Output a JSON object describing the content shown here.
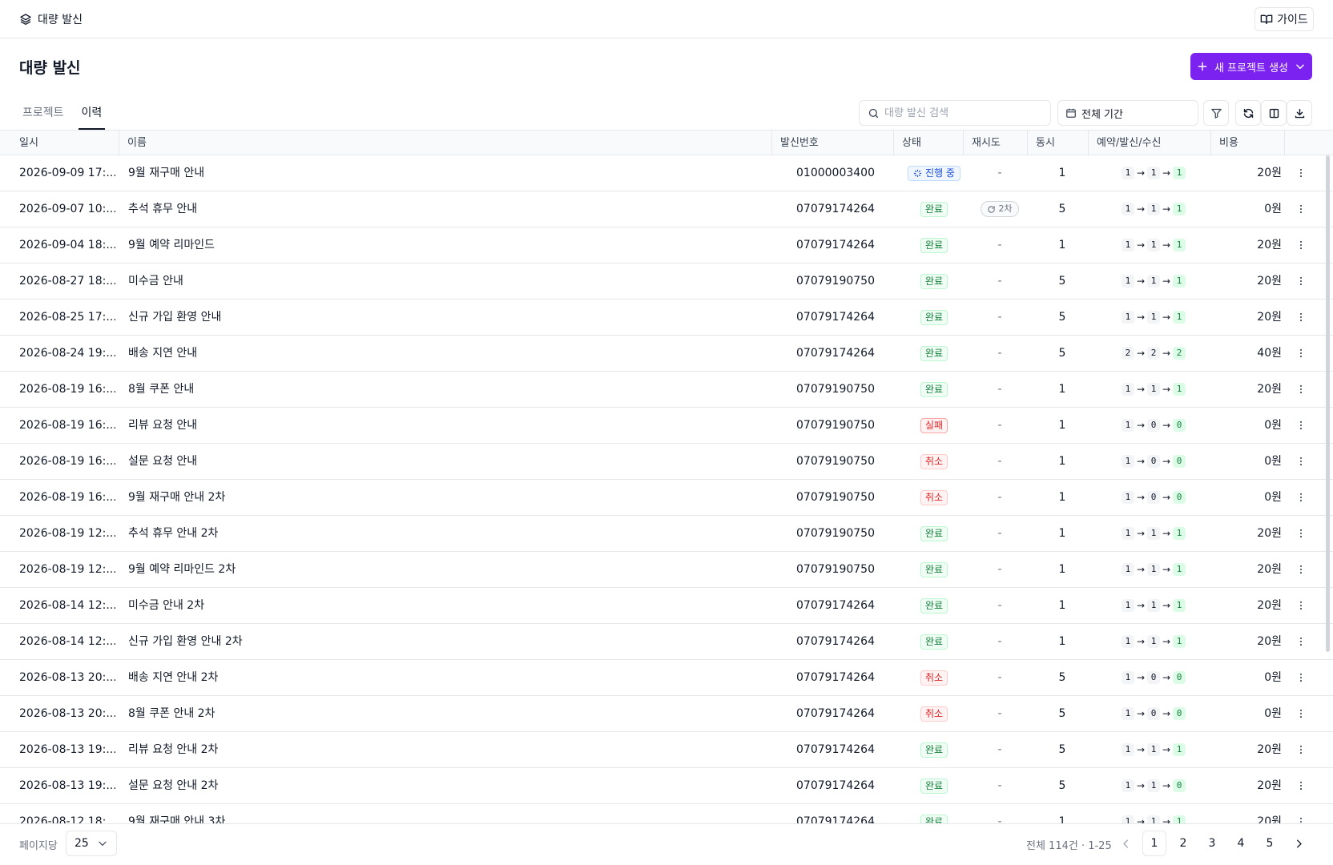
{
  "topbar": {
    "breadcrumb": "대량 발신",
    "guide_label": "가이드"
  },
  "page": {
    "title": "대량 발신",
    "new_project_label": "새 프로젝트 생성"
  },
  "tabs": [
    {
      "label": "프로젝트"
    },
    {
      "label": "이력"
    }
  ],
  "toolbar": {
    "search_placeholder": "대량 발신 검색",
    "period_label": "전체 기간"
  },
  "columns": {
    "date": "일시",
    "name": "이름",
    "number": "발신번호",
    "status": "상태",
    "retry": "재시도",
    "concurrent": "동시",
    "flow": "예약/발신/수신",
    "cost": "비용"
  },
  "colors": {
    "accent": "#7c22f0",
    "done": "#15803d",
    "fail": "#dc2626",
    "progress": "#1d4ed8"
  },
  "rows": [
    {
      "date": "2026-09-09 17:...",
      "name": "9월 재구매 안내",
      "number": "01000003400",
      "status": "진행 중",
      "status_type": "progress",
      "retry": "-",
      "concurrent": "1",
      "reserved": "1",
      "sent": "1",
      "received": "1",
      "cost": "20원"
    },
    {
      "date": "2026-09-07 10:...",
      "name": "추석 휴무 안내",
      "number": "07079174264",
      "status": "완료",
      "status_type": "done",
      "retry": "2차",
      "concurrent": "5",
      "reserved": "1",
      "sent": "1",
      "received": "1",
      "cost": "0원"
    },
    {
      "date": "2026-09-04 18:...",
      "name": "9월 예약 리마인드",
      "number": "07079174264",
      "status": "완료",
      "status_type": "done",
      "retry": "-",
      "concurrent": "1",
      "reserved": "1",
      "sent": "1",
      "received": "1",
      "cost": "20원"
    },
    {
      "date": "2026-08-27 18:...",
      "name": "미수금 안내",
      "number": "07079190750",
      "status": "완료",
      "status_type": "done",
      "retry": "-",
      "concurrent": "5",
      "reserved": "1",
      "sent": "1",
      "received": "1",
      "cost": "20원"
    },
    {
      "date": "2026-08-25 17:...",
      "name": "신규 가입 환영 안내",
      "number": "07079174264",
      "status": "완료",
      "status_type": "done",
      "retry": "-",
      "concurrent": "5",
      "reserved": "1",
      "sent": "1",
      "received": "1",
      "cost": "20원"
    },
    {
      "date": "2026-08-24 19:...",
      "name": "배송 지연 안내",
      "number": "07079174264",
      "status": "완료",
      "status_type": "done",
      "retry": "-",
      "concurrent": "5",
      "reserved": "2",
      "sent": "2",
      "received": "2",
      "cost": "40원"
    },
    {
      "date": "2026-08-19 16:...",
      "name": "8월 쿠폰 안내",
      "number": "07079190750",
      "status": "완료",
      "status_type": "done",
      "retry": "-",
      "concurrent": "1",
      "reserved": "1",
      "sent": "1",
      "received": "1",
      "cost": "20원"
    },
    {
      "date": "2026-08-19 16:...",
      "name": "리뷰 요청 안내",
      "number": "07079190750",
      "status": "실패",
      "status_type": "fail",
      "retry": "-",
      "concurrent": "1",
      "reserved": "1",
      "sent": "0",
      "received": "0",
      "cost": "0원"
    },
    {
      "date": "2026-08-19 16:...",
      "name": "설문 요청 안내",
      "number": "07079190750",
      "status": "취소",
      "status_type": "cancel",
      "retry": "-",
      "concurrent": "1",
      "reserved": "1",
      "sent": "0",
      "received": "0",
      "cost": "0원"
    },
    {
      "date": "2026-08-19 16:...",
      "name": "9월 재구매 안내 2차",
      "number": "07079190750",
      "status": "취소",
      "status_type": "cancel",
      "retry": "-",
      "concurrent": "1",
      "reserved": "1",
      "sent": "0",
      "received": "0",
      "cost": "0원"
    },
    {
      "date": "2026-08-19 12:...",
      "name": "추석 휴무 안내 2차",
      "number": "07079190750",
      "status": "완료",
      "status_type": "done",
      "retry": "-",
      "concurrent": "1",
      "reserved": "1",
      "sent": "1",
      "received": "1",
      "cost": "20원"
    },
    {
      "date": "2026-08-19 12:...",
      "name": "9월 예약 리마인드 2차",
      "number": "07079190750",
      "status": "완료",
      "status_type": "done",
      "retry": "-",
      "concurrent": "1",
      "reserved": "1",
      "sent": "1",
      "received": "1",
      "cost": "20원"
    },
    {
      "date": "2026-08-14 12:...",
      "name": "미수금 안내 2차",
      "number": "07079174264",
      "status": "완료",
      "status_type": "done",
      "retry": "-",
      "concurrent": "1",
      "reserved": "1",
      "sent": "1",
      "received": "1",
      "cost": "20원"
    },
    {
      "date": "2026-08-14 12:...",
      "name": "신규 가입 환영 안내 2차",
      "number": "07079174264",
      "status": "완료",
      "status_type": "done",
      "retry": "-",
      "concurrent": "1",
      "reserved": "1",
      "sent": "1",
      "received": "1",
      "cost": "20원"
    },
    {
      "date": "2026-08-13 20:...",
      "name": "배송 지연 안내 2차",
      "number": "07079174264",
      "status": "취소",
      "status_type": "cancel",
      "retry": "-",
      "concurrent": "5",
      "reserved": "1",
      "sent": "0",
      "received": "0",
      "cost": "0원"
    },
    {
      "date": "2026-08-13 20:...",
      "name": "8월 쿠폰 안내 2차",
      "number": "07079174264",
      "status": "취소",
      "status_type": "cancel",
      "retry": "-",
      "concurrent": "5",
      "reserved": "1",
      "sent": "0",
      "received": "0",
      "cost": "0원"
    },
    {
      "date": "2026-08-13 19:...",
      "name": "리뷰 요청 안내 2차",
      "number": "07079174264",
      "status": "완료",
      "status_type": "done",
      "retry": "-",
      "concurrent": "5",
      "reserved": "1",
      "sent": "1",
      "received": "1",
      "cost": "20원"
    },
    {
      "date": "2026-08-13 19:...",
      "name": "설문 요청 안내 2차",
      "number": "07079174264",
      "status": "완료",
      "status_type": "done",
      "retry": "-",
      "concurrent": "5",
      "reserved": "1",
      "sent": "1",
      "received": "0",
      "cost": "20원"
    },
    {
      "date": "2026-08-12 18:...",
      "name": "9월 재구매 안내 3차",
      "number": "07079174264",
      "status": "완료",
      "status_type": "done",
      "retry": "-",
      "concurrent": "1",
      "reserved": "1",
      "sent": "1",
      "received": "1",
      "cost": "20원"
    }
  ],
  "footer": {
    "per_page_label": "페이지당",
    "per_page_value": "25",
    "total_text": "전체 114건 · 1-25",
    "pages": [
      "1",
      "2",
      "3",
      "4",
      "5"
    ],
    "current_page": "1"
  }
}
